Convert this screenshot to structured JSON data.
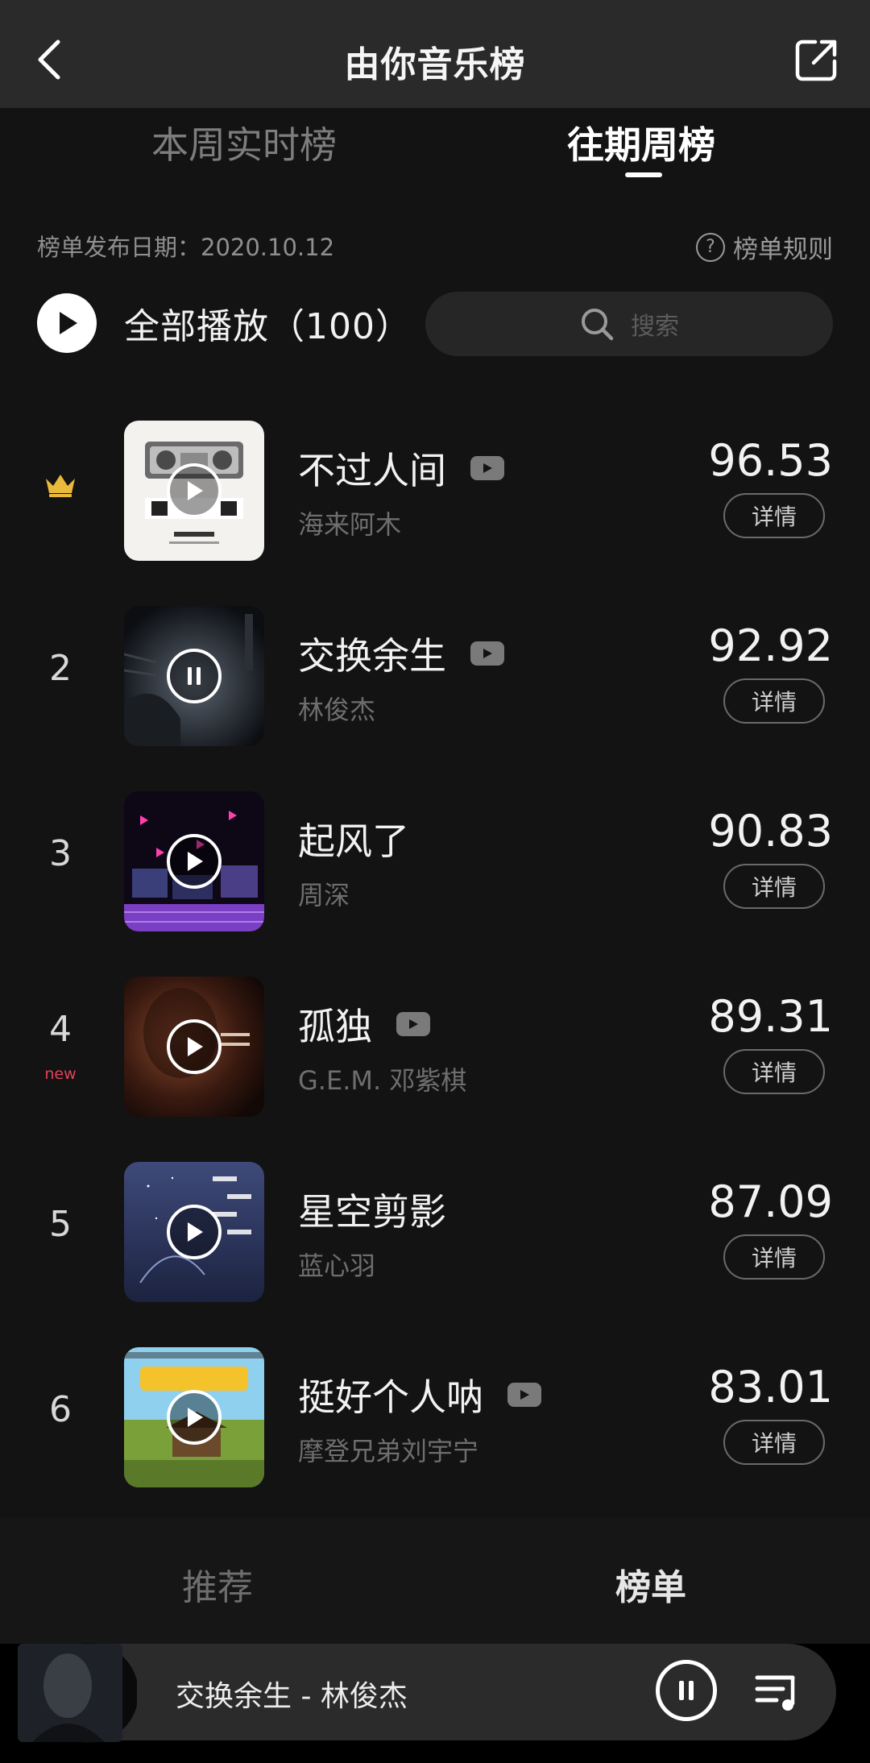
{
  "header": {
    "title": "由你音乐榜",
    "back_icon": "chevron-left-icon",
    "share_icon": "share-icon"
  },
  "tabs": [
    {
      "label": "本周实时榜",
      "active": false
    },
    {
      "label": "往期周榜",
      "active": true
    }
  ],
  "info": {
    "publish_date": "榜单发布日期：2020.10.12",
    "rules_label": "榜单规则"
  },
  "play_all": {
    "label": "全部播放（100）"
  },
  "search": {
    "placeholder": "搜索"
  },
  "songs": [
    {
      "rank": "",
      "badge": "crown-icon",
      "is_new": false,
      "title": "不过人间",
      "has_mv": true,
      "artist": "海来阿木",
      "score": "96.53",
      "detail_label": "详情",
      "playing": false
    },
    {
      "rank": "2",
      "badge": "",
      "is_new": false,
      "title": "交换余生",
      "has_mv": true,
      "artist": "林俊杰",
      "score": "92.92",
      "detail_label": "详情",
      "playing": true
    },
    {
      "rank": "3",
      "badge": "",
      "is_new": false,
      "title": "起风了",
      "has_mv": false,
      "artist": "周深",
      "score": "90.83",
      "detail_label": "详情",
      "playing": false
    },
    {
      "rank": "4",
      "badge": "",
      "is_new": true,
      "new_label": "new",
      "title": "孤独",
      "has_mv": true,
      "artist": "G.E.M. 邓紫棋",
      "score": "89.31",
      "detail_label": "详情",
      "playing": false
    },
    {
      "rank": "5",
      "badge": "",
      "is_new": false,
      "title": "星空剪影",
      "has_mv": false,
      "artist": "蓝心羽",
      "score": "87.09",
      "detail_label": "详情",
      "playing": false
    },
    {
      "rank": "6",
      "badge": "",
      "is_new": false,
      "title": "挺好个人呐",
      "has_mv": true,
      "artist": "摩登兄弟刘宇宁",
      "score": "83.01",
      "detail_label": "详情",
      "playing": false
    }
  ],
  "bottom_nav": [
    {
      "label": "推荐",
      "active": false
    },
    {
      "label": "榜单",
      "active": true
    }
  ],
  "mini_player": {
    "now_playing": "交换余生 - 林俊杰",
    "state": "playing"
  },
  "colors": {
    "background": "#131313",
    "header": "#2a2a2a",
    "new_badge": "#e0425a",
    "crown": "#e8b93a"
  }
}
